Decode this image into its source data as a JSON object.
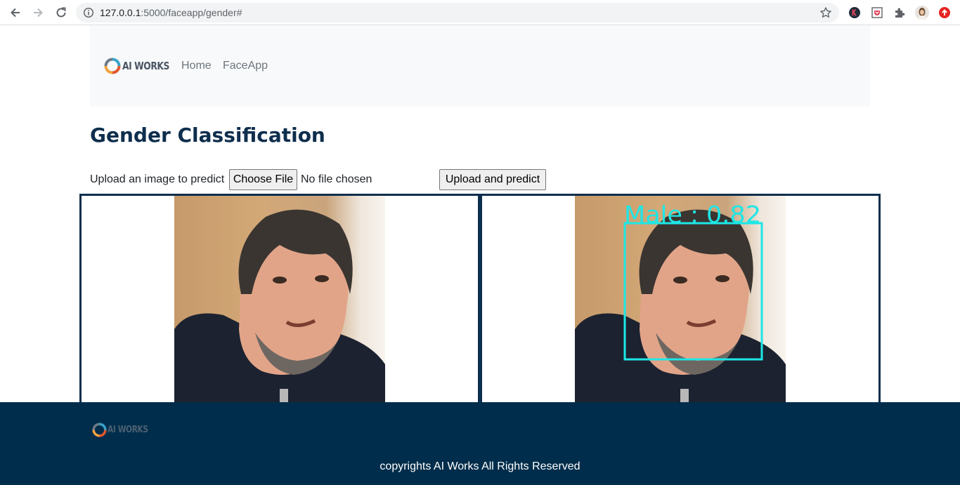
{
  "browser": {
    "url_host": "127.0.0.1",
    "url_path": ":5000/faceapp/gender#",
    "avatar_letter": "K"
  },
  "navbar": {
    "brand": "AI WORKS",
    "links": [
      "Home",
      "FaceApp"
    ]
  },
  "page": {
    "title": "Gender Classification"
  },
  "upload": {
    "label": "Upload an image to predict",
    "choose_file": "Choose File",
    "file_status": "No file chosen",
    "submit": "Upload and predict"
  },
  "prediction": {
    "label": "Male : 0.82",
    "box_color": "#1ee6e6"
  },
  "footer": {
    "brand": "AI WORKS",
    "copyright": "copyrights AI Works All Rights Reserved"
  },
  "colors": {
    "primary": "#0e2e4d",
    "footer_bg": "#002d4b",
    "navbar_bg": "#f8f9fa"
  }
}
